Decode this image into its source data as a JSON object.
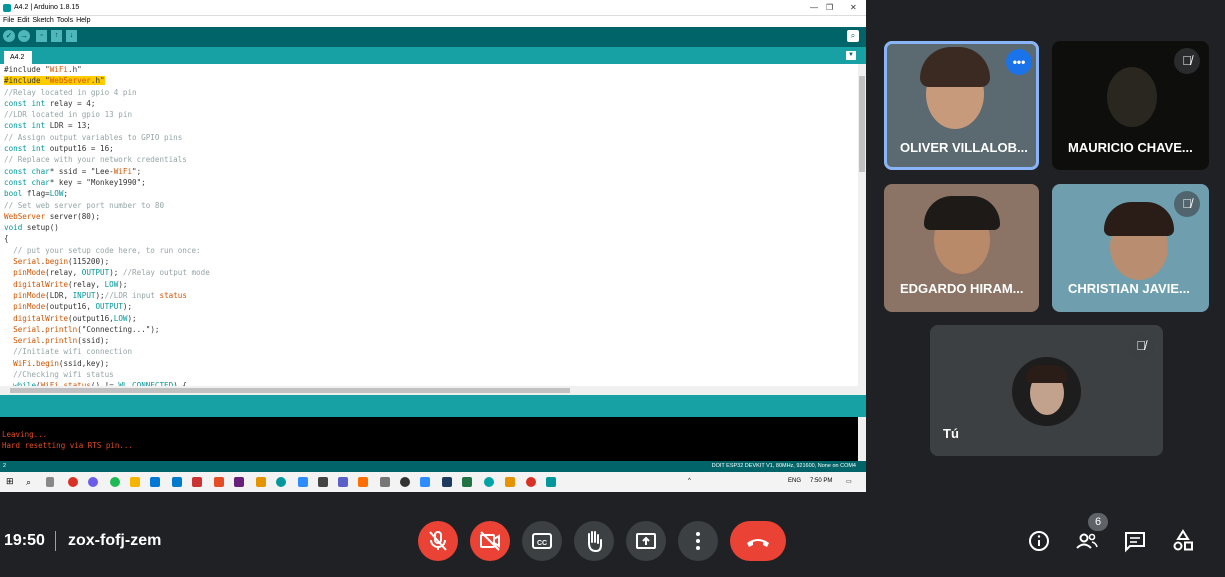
{
  "shared_screen": {
    "window_title": "A4.2 | Arduino 1.8.15",
    "window_controls": [
      "—",
      "❐",
      "✕"
    ],
    "menu": [
      "File",
      "Edit",
      "Sketch",
      "Tools",
      "Help"
    ],
    "toolbar_icons": [
      "verify-icon",
      "upload-icon",
      "new-icon",
      "open-icon",
      "save-icon",
      "serial-monitor-icon"
    ],
    "tab_label": "A4.2",
    "code_lines": [
      "#include \"WiFi.h\"",
      "#include \"WebServer.h\"",
      "//Relay located in gpio 4 pin",
      "const int relay = 4;",
      "//LDR located in gpio 13 pin",
      "const int LDR = 13;",
      "// Assign output variables to GPIO pins",
      "const int output16 = 16;",
      "// Replace with your network credentials",
      "const char* ssid = \"Lee-WiFi\";",
      "const char* key = \"Monkey1990\";",
      "bool flag=LOW;",
      "// Set web server port number to 80",
      "WebServer server(80);",
      "void setup()",
      "{",
      "  // put your setup code here, to run once:",
      "  Serial.begin(115200);",
      "  pinMode(relay, OUTPUT); //Relay output mode",
      "  digitalWrite(relay, LOW);",
      "  pinMode(LDR, INPUT);//LDR input status",
      "  pinMode(output16, OUTPUT);",
      "  digitalWrite(output16,LOW);",
      "  Serial.println(\"Connecting...\");",
      "  Serial.println(ssid);",
      "  //Initiate wifi connection",
      "  WiFi.begin(ssid,key);",
      "  //Checking wifi status",
      "  while(WiFi.status() != WL_CONNECTED) {"
    ],
    "console_lines": [
      "Leaving...",
      "Hard resetting via RTS pin..."
    ],
    "status_line": "2",
    "status_board": "DOIT ESP32 DEVKIT V1, 80MHz, 921600, None on COM4",
    "taskbar": {
      "language": "ENG",
      "clock": "7:50 PM"
    }
  },
  "participants": [
    {
      "name": "OLIVER VILLALOB...",
      "state": "speaking"
    },
    {
      "name": "MAURICIO CHAVE...",
      "state": "muted"
    },
    {
      "name": "EDGARDO HIRAM...",
      "state": "muted"
    },
    {
      "name": "CHRISTIAN JAVIE...",
      "state": "muted"
    },
    {
      "name": "Tú",
      "state": "muted"
    }
  ],
  "meeting": {
    "time": "19:50",
    "code": "zox-fofj-zem",
    "people_count": "6"
  },
  "colors": {
    "arduino_teal": "#006468",
    "arduino_light": "#17a1a5",
    "meet_red": "#ea4335",
    "meet_blue": "#1a73e8"
  }
}
